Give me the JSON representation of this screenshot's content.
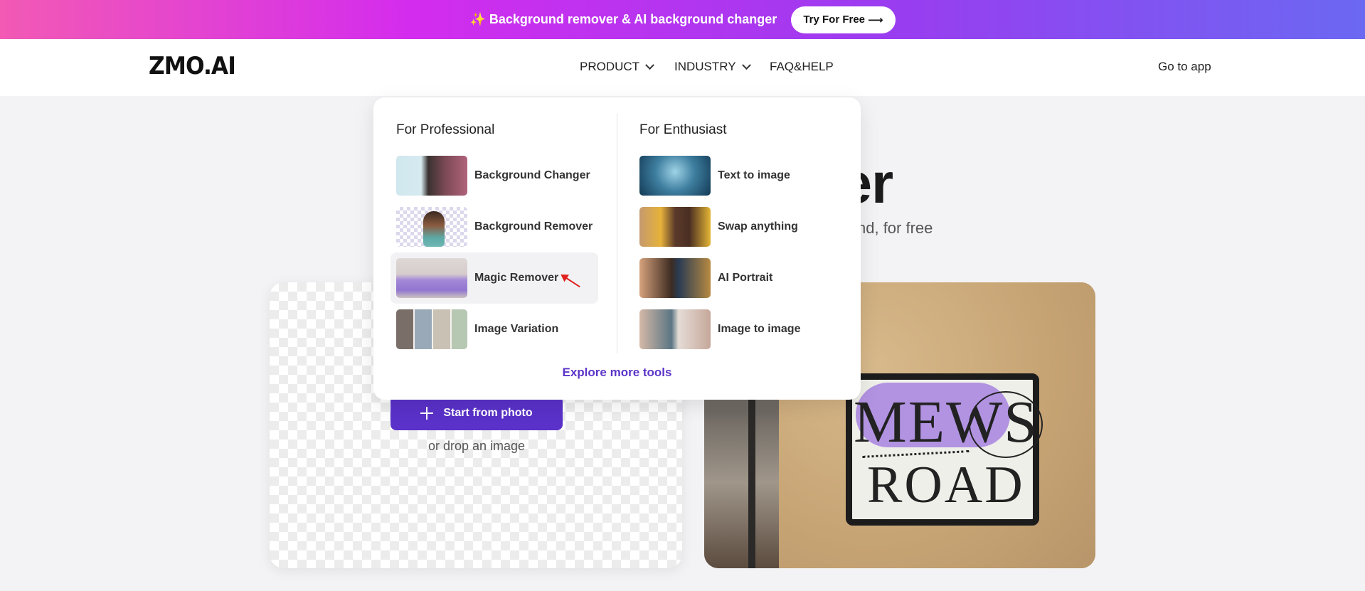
{
  "promo": {
    "sparkle": "✨",
    "text": "Background remover & AI background changer",
    "button": "Try For Free",
    "arrow": "⟶"
  },
  "nav": {
    "logo": "ZMO.AI",
    "product": "PRODUCT",
    "industry": "INDUSTRY",
    "faq": "FAQ&HELP",
    "go_app": "Go to app"
  },
  "hero": {
    "title_visible": "ver",
    "subtitle_visible": "nd, for free"
  },
  "menu": {
    "professional": {
      "heading": "For Professional",
      "items": [
        {
          "label": "Background Changer"
        },
        {
          "label": "Background Remover"
        },
        {
          "label": "Magic Remover"
        },
        {
          "label": "Image Variation"
        }
      ]
    },
    "enthusiast": {
      "heading": "For Enthusiast",
      "items": [
        {
          "label": "Text to image"
        },
        {
          "label": "Swap anything"
        },
        {
          "label": "AI Portrait"
        },
        {
          "label": "Image to image"
        }
      ]
    },
    "explore": "Explore more tools"
  },
  "upload": {
    "button": "Start from photo",
    "drop": "or drop an image"
  },
  "example": {
    "line1": "MEWS",
    "line2": "ROAD"
  },
  "colors": {
    "accent": "#5a31c9",
    "link": "#5b34c9",
    "page_bg": "#f3f3f5"
  }
}
